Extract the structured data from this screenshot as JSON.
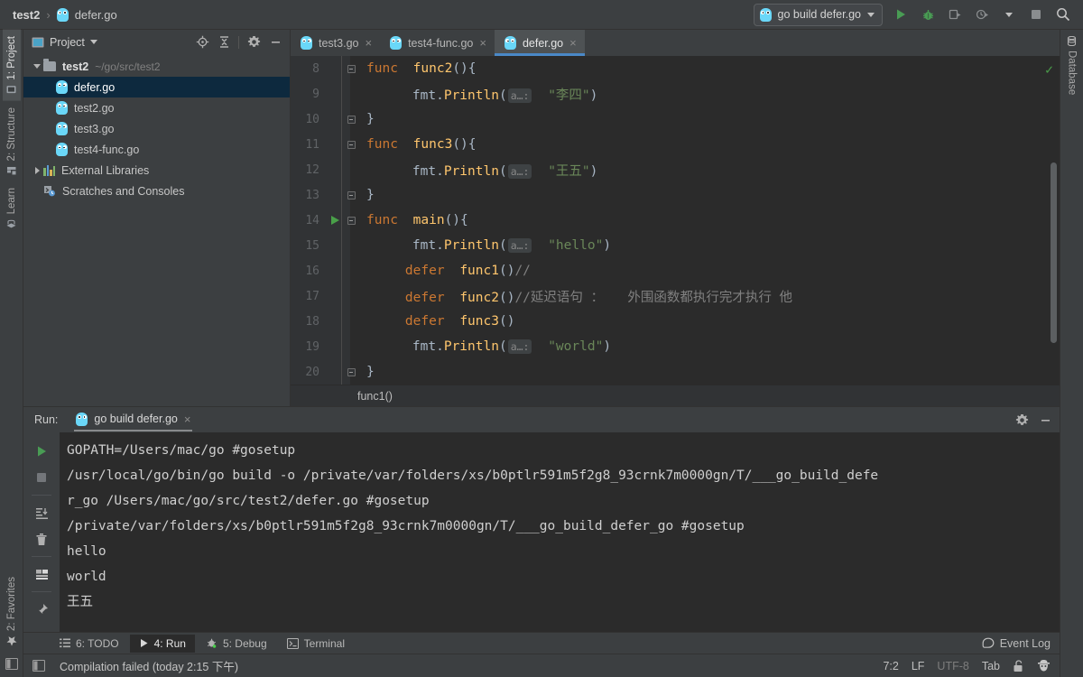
{
  "breadcrumb": {
    "project": "test2",
    "separator": "›",
    "file": "defer.go",
    "file_icon": "gopher-icon"
  },
  "toolbar": {
    "run_config": "go build defer.go",
    "icons": [
      "run-icon",
      "debug-icon",
      "run-with-coverage-icon",
      "profile-icon",
      "dropdown-icon",
      "stop-icon",
      "search-icon"
    ]
  },
  "left_strip": {
    "tabs": [
      {
        "label": "1: Project",
        "mnemonic": "1",
        "rest": ": Project",
        "icon": "project-icon",
        "active": true
      },
      {
        "label": "2: Structure",
        "mnemonic": "2",
        "rest": ": Structure",
        "icon": "structure-icon",
        "active": false
      },
      {
        "label": "Learn",
        "mnemonic": "",
        "rest": "Learn",
        "icon": "learn-icon",
        "active": false
      },
      {
        "label": "2: Favorites",
        "mnemonic": "2",
        "rest": ": Favorites",
        "icon": "star-icon",
        "active": false
      }
    ],
    "bottom_icon": "toggle-sidebar-icon"
  },
  "right_strip": {
    "tabs": [
      {
        "label": "Database",
        "icon": "database-icon"
      }
    ]
  },
  "project_panel": {
    "title": "Project",
    "head_icons": [
      "locate-icon",
      "collapse-all-icon",
      "gear-icon",
      "minimize-icon"
    ],
    "tree": [
      {
        "label": "test2",
        "path": "~/go/src/test2",
        "icon": "folder-icon",
        "arrow": "down",
        "indent": 0,
        "bold": true,
        "selected": false
      },
      {
        "label": "defer.go",
        "path": "",
        "icon": "gopher-icon",
        "arrow": "",
        "indent": 1,
        "bold": false,
        "selected": true
      },
      {
        "label": "test2.go",
        "path": "",
        "icon": "gopher-icon",
        "arrow": "",
        "indent": 1,
        "bold": false,
        "selected": false
      },
      {
        "label": "test3.go",
        "path": "",
        "icon": "gopher-icon",
        "arrow": "",
        "indent": 1,
        "bold": false,
        "selected": false
      },
      {
        "label": "test4-func.go",
        "path": "",
        "icon": "gopher-icon",
        "arrow": "",
        "indent": 1,
        "bold": false,
        "selected": false
      },
      {
        "label": "External Libraries",
        "path": "",
        "icon": "libraries-icon",
        "arrow": "right",
        "indent": 0,
        "bold": false,
        "selected": false
      },
      {
        "label": "Scratches and Consoles",
        "path": "",
        "icon": "scratches-icon",
        "arrow": "",
        "indent": 0,
        "bold": false,
        "selected": false
      }
    ]
  },
  "editor": {
    "tabs": [
      {
        "label": "test3.go",
        "icon": "gopher-icon",
        "active": false,
        "close": "×"
      },
      {
        "label": "test4-func.go",
        "icon": "gopher-icon",
        "active": false,
        "close": "×"
      },
      {
        "label": "defer.go",
        "icon": "gopher-icon",
        "active": true,
        "close": "×"
      }
    ],
    "breadcrumb": "func1()",
    "inspection_status": "✓",
    "lines": [
      {
        "n": "8",
        "fold": "start",
        "gutter": "",
        "tokens": [
          {
            "t": "kw",
            "v": "func"
          },
          {
            "t": "sp",
            "v": " "
          },
          {
            "t": "fn",
            "v": "func2"
          },
          {
            "t": "punc",
            "v": "(){"
          }
        ]
      },
      {
        "n": "9",
        "fold": "",
        "gutter": "",
        "tokens": [
          {
            "t": "sp",
            "v": "    "
          },
          {
            "t": "plain",
            "v": "fmt."
          },
          {
            "t": "fn",
            "v": "Println"
          },
          {
            "t": "punc",
            "v": "("
          },
          {
            "t": "hint",
            "v": "a…:"
          },
          {
            "t": "sp",
            "v": " "
          },
          {
            "t": "str",
            "v": "\"李四\""
          },
          {
            "t": "punc",
            "v": ")"
          }
        ]
      },
      {
        "n": "10",
        "fold": "end",
        "gutter": "",
        "tokens": [
          {
            "t": "punc",
            "v": "}"
          }
        ]
      },
      {
        "n": "11",
        "fold": "start",
        "gutter": "",
        "tokens": [
          {
            "t": "kw",
            "v": "func"
          },
          {
            "t": "sp",
            "v": " "
          },
          {
            "t": "fn",
            "v": "func3"
          },
          {
            "t": "punc",
            "v": "(){"
          }
        ]
      },
      {
        "n": "12",
        "fold": "",
        "gutter": "",
        "tokens": [
          {
            "t": "sp",
            "v": "    "
          },
          {
            "t": "plain",
            "v": "fmt."
          },
          {
            "t": "fn",
            "v": "Println"
          },
          {
            "t": "punc",
            "v": "("
          },
          {
            "t": "hint",
            "v": "a…:"
          },
          {
            "t": "sp",
            "v": " "
          },
          {
            "t": "str",
            "v": "\"王五\""
          },
          {
            "t": "punc",
            "v": ")"
          }
        ]
      },
      {
        "n": "13",
        "fold": "end",
        "gutter": "",
        "tokens": [
          {
            "t": "punc",
            "v": "}"
          }
        ]
      },
      {
        "n": "14",
        "fold": "start",
        "gutter": "run",
        "tokens": [
          {
            "t": "kw",
            "v": "func"
          },
          {
            "t": "sp",
            "v": " "
          },
          {
            "t": "fn",
            "v": "main"
          },
          {
            "t": "punc",
            "v": "(){"
          }
        ]
      },
      {
        "n": "15",
        "fold": "",
        "gutter": "",
        "tokens": [
          {
            "t": "sp",
            "v": "    "
          },
          {
            "t": "plain",
            "v": "fmt."
          },
          {
            "t": "fn",
            "v": "Println"
          },
          {
            "t": "punc",
            "v": "("
          },
          {
            "t": "hint",
            "v": "a…:"
          },
          {
            "t": "sp",
            "v": " "
          },
          {
            "t": "str",
            "v": "\"hello\""
          },
          {
            "t": "punc",
            "v": ")"
          }
        ]
      },
      {
        "n": "16",
        "fold": "",
        "gutter": "",
        "tokens": [
          {
            "t": "sp",
            "v": "    "
          },
          {
            "t": "kw",
            "v": "defer"
          },
          {
            "t": "sp",
            "v": " "
          },
          {
            "t": "fn",
            "v": "func1"
          },
          {
            "t": "punc",
            "v": "()"
          },
          {
            "t": "cmt",
            "v": "//"
          }
        ]
      },
      {
        "n": "17",
        "fold": "",
        "gutter": "",
        "tokens": [
          {
            "t": "sp",
            "v": "    "
          },
          {
            "t": "kw",
            "v": "defer"
          },
          {
            "t": "sp",
            "v": " "
          },
          {
            "t": "fn",
            "v": "func2"
          },
          {
            "t": "punc",
            "v": "()"
          },
          {
            "t": "cmt",
            "v": "//延迟语句 ：   外围函数都执行完才执行 他"
          }
        ]
      },
      {
        "n": "18",
        "fold": "",
        "gutter": "",
        "tokens": [
          {
            "t": "sp",
            "v": "    "
          },
          {
            "t": "kw",
            "v": "defer"
          },
          {
            "t": "sp",
            "v": " "
          },
          {
            "t": "fn",
            "v": "func3"
          },
          {
            "t": "punc",
            "v": "()"
          }
        ]
      },
      {
        "n": "19",
        "fold": "",
        "gutter": "",
        "tokens": [
          {
            "t": "sp",
            "v": "    "
          },
          {
            "t": "plain",
            "v": "fmt."
          },
          {
            "t": "fn",
            "v": "Println"
          },
          {
            "t": "punc",
            "v": "("
          },
          {
            "t": "hint",
            "v": "a…:"
          },
          {
            "t": "sp",
            "v": " "
          },
          {
            "t": "str",
            "v": "\"world\""
          },
          {
            "t": "punc",
            "v": ")"
          }
        ]
      },
      {
        "n": "20",
        "fold": "end",
        "gutter": "",
        "tokens": [
          {
            "t": "punc",
            "v": "}"
          }
        ]
      }
    ]
  },
  "run_panel": {
    "label": "Run:",
    "tab": "go build defer.go",
    "tab_icon": "gopher-icon",
    "tab_close": "×",
    "head_icons": [
      "gear-icon",
      "minimize-icon"
    ],
    "tools": [
      "rerun-icon",
      "stop-icon",
      "scroll-to-end-icon",
      "trash-icon",
      "soft-wrap-icon",
      "pin-icon"
    ],
    "console": [
      "GOPATH=/Users/mac/go #gosetup",
      "/usr/local/go/bin/go build -o /private/var/folders/xs/b0ptlr591m5f2g8_93crnk7m0000gn/T/___go_build_defe",
      "r_go /Users/mac/go/src/test2/defer.go #gosetup",
      "/private/var/folders/xs/b0ptlr591m5f2g8_93crnk7m0000gn/T/___go_build_defer_go #gosetup",
      "hello",
      "world",
      "王五"
    ]
  },
  "bottom_bar": {
    "tabs": [
      {
        "label": "6: TODO",
        "mnemonic": "6",
        "rest": ": TODO",
        "icon": "todo-icon",
        "active": false
      },
      {
        "label": "4: Run",
        "mnemonic": "4",
        "rest": ": Run",
        "icon": "run-icon",
        "active": true
      },
      {
        "label": "5: Debug",
        "mnemonic": "5",
        "rest": ": Debug",
        "icon": "debug-icon",
        "active": false
      },
      {
        "label": "Terminal",
        "mnemonic": "",
        "rest": "Terminal",
        "icon": "terminal-icon",
        "active": false
      }
    ],
    "event_log": "Event Log",
    "event_log_icon": "event-log-icon"
  },
  "status_bar": {
    "message": "Compilation failed (today 2:15 下午)",
    "caret": "7:2",
    "line_ending": "LF",
    "encoding": "UTF-8",
    "indent": "Tab",
    "lock_icon": "unlocked-icon",
    "inspector_icon": "hector-icon"
  },
  "colors": {
    "bg_chrome": "#3c3f41",
    "bg_editor": "#2b2b2b",
    "accent_blue": "#4a88c7",
    "selection": "#0d293e",
    "keyword": "#cc7832",
    "function": "#ffc66d",
    "string": "#6a8759",
    "comment": "#808080",
    "run_green": "#499c54"
  }
}
